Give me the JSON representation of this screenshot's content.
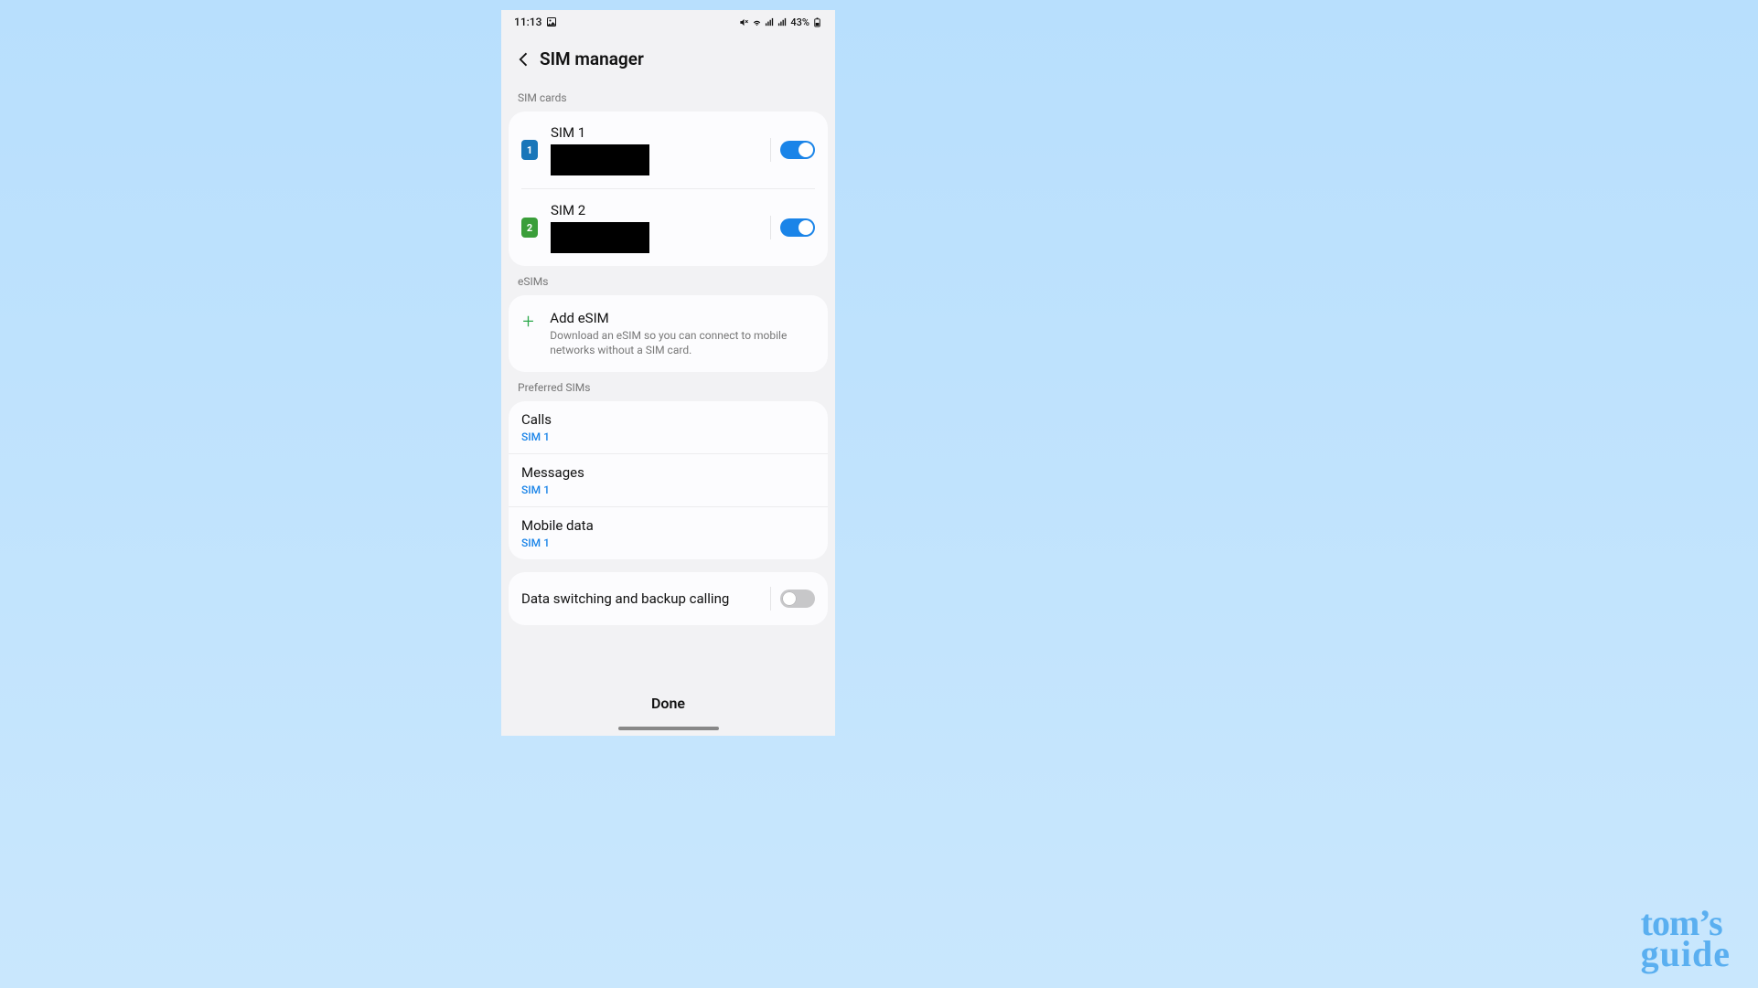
{
  "status": {
    "time": "11:13",
    "battery": "43%"
  },
  "header": {
    "title": "SIM manager"
  },
  "sections": {
    "simCards": {
      "label": "SIM cards",
      "items": [
        {
          "badge": "1",
          "name": "SIM 1",
          "enabled": true
        },
        {
          "badge": "2",
          "name": "SIM 2",
          "enabled": true
        }
      ]
    },
    "esims": {
      "label": "eSIMs",
      "add": {
        "title": "Add eSIM",
        "description": "Download an eSIM so you can connect to mobile networks without a SIM card."
      }
    },
    "preferred": {
      "label": "Preferred SIMs",
      "items": [
        {
          "title": "Calls",
          "value": "SIM 1"
        },
        {
          "title": "Messages",
          "value": "SIM 1"
        },
        {
          "title": "Mobile data",
          "value": "SIM 1"
        }
      ]
    },
    "dataSwitching": {
      "label": "Data switching and backup calling",
      "enabled": false
    }
  },
  "footer": {
    "done": "Done"
  },
  "watermark": {
    "line1": "tom’s",
    "line2": "guide"
  }
}
